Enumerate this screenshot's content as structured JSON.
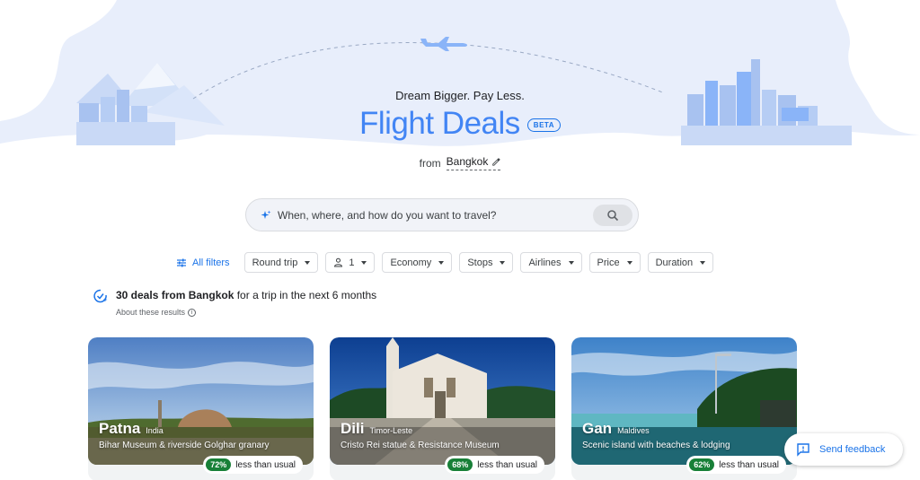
{
  "hero": {
    "tagline": "Dream Bigger. Pay Less.",
    "title": "Flight Deals",
    "beta_badge": "BETA"
  },
  "origin": {
    "from_label": "from",
    "city": "Bangkok",
    "edit_icon": "pencil-icon"
  },
  "search": {
    "placeholder": "When, where, and how do you want to travel?",
    "sparkle_icon": "sparkle-icon",
    "button_icon": "search-icon"
  },
  "filters": {
    "all_filters_label": "All filters",
    "trip_type": "Round trip",
    "passengers": "1",
    "cabin": "Economy",
    "stops": "Stops",
    "airlines": "Airlines",
    "price": "Price",
    "duration": "Duration"
  },
  "summary": {
    "count_text": "30 deals from Bangkok",
    "rest_text": " for a trip in the next 6 months",
    "about_text": "About these results"
  },
  "deals": [
    {
      "city": "Patna",
      "country": "India",
      "description": "Bihar Museum & riverside Golghar granary",
      "percent": "72%",
      "deal_text": "less than usual"
    },
    {
      "city": "Dili",
      "country": "Timor-Leste",
      "description": "Cristo Rei statue & Resistance Museum",
      "percent": "68%",
      "deal_text": "less than usual"
    },
    {
      "city": "Gan",
      "country": "Maldives",
      "description": "Scenic island with beaches & lodging",
      "percent": "62%",
      "deal_text": "less than usual"
    }
  ],
  "feedback": {
    "label": "Send feedback"
  },
  "colors": {
    "accent": "#1a73e8",
    "title": "#4285f4",
    "deal_green": "#188038",
    "hero_sky": "#e8eefb"
  }
}
